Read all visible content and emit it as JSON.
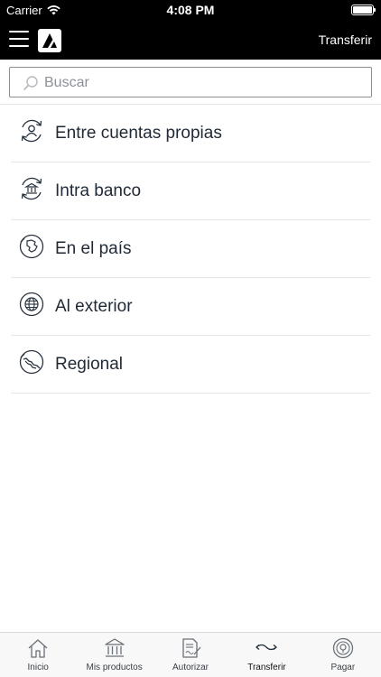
{
  "status_bar": {
    "carrier": "Carrier",
    "time": "4:08 PM"
  },
  "header": {
    "title": "Transferir"
  },
  "search": {
    "placeholder": "Buscar"
  },
  "transfer_options": [
    {
      "label": "Entre cuentas propias",
      "icon": "user-transfer-icon"
    },
    {
      "label": "Intra banco",
      "icon": "bank-transfer-icon"
    },
    {
      "label": "En el país",
      "icon": "country-map-icon"
    },
    {
      "label": "Al exterior",
      "icon": "globe-icon"
    },
    {
      "label": "Regional",
      "icon": "region-map-icon"
    }
  ],
  "tab_bar": [
    {
      "label": "Inicio",
      "icon": "home-icon"
    },
    {
      "label": "Mis productos",
      "icon": "bank-icon"
    },
    {
      "label": "Autorizar",
      "icon": "sign-document-icon"
    },
    {
      "label": "Transferir",
      "icon": "transfer-arrows-icon",
      "active": true
    },
    {
      "label": "Pagar",
      "icon": "pay-coin-icon"
    }
  ],
  "colors": {
    "header_bg": "#000000",
    "text": "#1f2a36",
    "divider": "#e3e6ea",
    "tab_bar_bg": "#f8f8f8"
  }
}
